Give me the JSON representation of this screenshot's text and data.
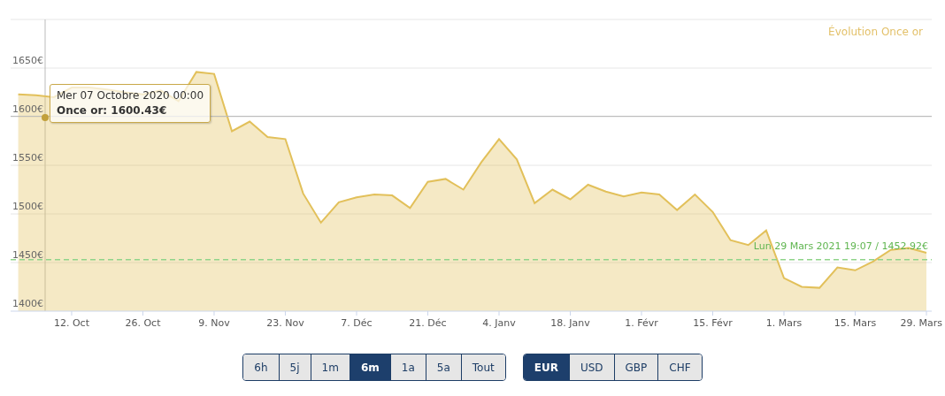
{
  "chart": {
    "chart_data": {
      "type": "area",
      "title": "Évolution Once or",
      "categories": [
        null,
        null,
        null,
        "12. Oct",
        null,
        null,
        null,
        "26. Oct",
        null,
        null,
        null,
        "9. Nov",
        null,
        null,
        null,
        "23. Nov",
        null,
        null,
        null,
        "7. Déc",
        null,
        null,
        null,
        "21. Déc",
        null,
        null,
        null,
        "4. Janv",
        null,
        null,
        null,
        "18. Janv",
        null,
        null,
        null,
        "1. Févr",
        null,
        null,
        null,
        "15. Févr",
        null,
        null,
        null,
        "1. Mars",
        null,
        null,
        null,
        "15. Mars",
        null,
        null,
        null,
        "29. Mars"
      ],
      "series": [
        {
          "color": "#e2c05a",
          "values": [
            1623,
            1622,
            1620,
            1630,
            1630,
            1628,
            1625,
            1623,
            1627,
            1616,
            1646,
            1644,
            1585,
            1595,
            1579,
            1577,
            1521,
            1491,
            1512,
            1517,
            1520,
            1519,
            1506,
            1533,
            1536,
            1525,
            1553,
            1577,
            1556,
            1511,
            1525,
            1515,
            1530,
            1523,
            1518,
            1522,
            1520,
            1504,
            1520,
            1502,
            1473,
            1468,
            1483,
            1434,
            1425,
            1424,
            1445,
            1442,
            1451,
            1463,
            1465,
            1460
          ]
        }
      ],
      "ylim": [
        1400,
        1700
      ],
      "yticks": [
        {
          "value": 1400,
          "label": "1400€"
        },
        {
          "value": 1450,
          "label": "1450€"
        },
        {
          "value": 1500,
          "label": "1500€"
        },
        {
          "value": 1550,
          "label": "1550€"
        },
        {
          "value": 1600,
          "label": "1600€"
        },
        {
          "value": 1650,
          "label": "1650€"
        }
      ],
      "grid": true,
      "ref_lines": [
        {
          "axis": "y",
          "value": 1600.43
        },
        {
          "axis": "y",
          "value": 1452.92,
          "label": "Lun 29 Mars 2021 19:07 / 1452.92€"
        }
      ]
    },
    "tooltip": {
      "date": "Mer 07 Octobre 2020 00:00",
      "text": "Once or: 1600.43€"
    }
  },
  "range_buttons": [
    {
      "label": "6h",
      "selected": false
    },
    {
      "label": "5j",
      "selected": false
    },
    {
      "label": "1m",
      "selected": false
    },
    {
      "label": "6m",
      "selected": true
    },
    {
      "label": "1a",
      "selected": false
    },
    {
      "label": "5a",
      "selected": false
    },
    {
      "label": "Tout",
      "selected": false
    }
  ],
  "currency_buttons": [
    {
      "label": "EUR",
      "selected": true
    },
    {
      "label": "USD",
      "selected": false
    },
    {
      "label": "GBP",
      "selected": false
    },
    {
      "label": "CHF",
      "selected": false
    }
  ]
}
